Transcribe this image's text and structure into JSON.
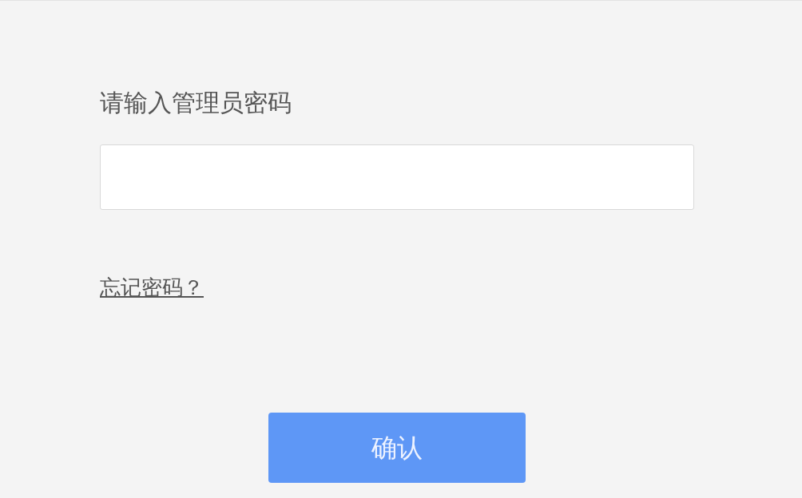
{
  "title": "请输入管理员密码",
  "forgot_link": "忘记密码？",
  "confirm_button": "确认"
}
